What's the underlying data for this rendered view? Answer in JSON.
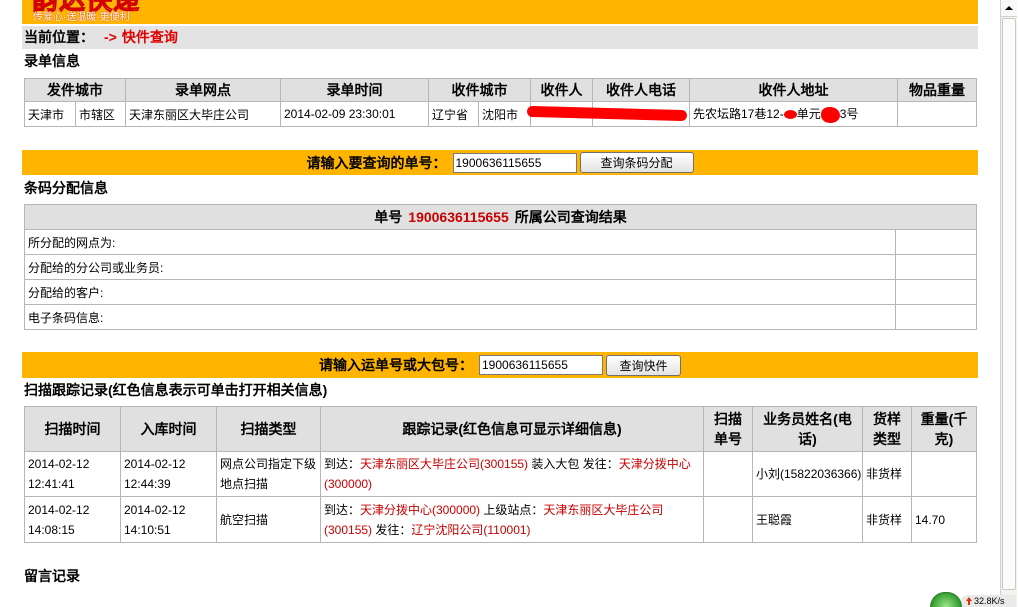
{
  "logo": {
    "name": "韵达快递",
    "slogan": "传爱心·送温暖·更便利"
  },
  "breadcrumb": {
    "label": "当前位置：",
    "arrow": "->",
    "current": "快件查询"
  },
  "order_info": {
    "title": "录单信息",
    "headers": [
      "发件城市",
      "录单网点",
      "录单时间",
      "收件城市",
      "收件人",
      "收件人电话",
      "收件人地址",
      "物品重量"
    ],
    "row": {
      "sender_province": "天津市",
      "sender_district": "市辖区",
      "outlet": "天津东丽区大毕庄公司",
      "time": "2014-02-09 23:30:01",
      "recipient_province": "辽宁省",
      "recipient_city": "沈阳市",
      "recipient_name": "",
      "recipient_phone": "",
      "address_parts": [
        "先农坛路17巷12-",
        "单元",
        "3号"
      ],
      "weight": ""
    }
  },
  "barcode_query": {
    "label": "请输入要查询的单号：",
    "value": "1900636115655",
    "button": "查询条码分配"
  },
  "barcode_info": {
    "title": "条码分配信息",
    "header_prefix": "单号",
    "header_number": "1900636115655",
    "header_suffix": "所属公司查询结果",
    "rows": [
      {
        "label": "所分配的网点为:",
        "value": ""
      },
      {
        "label": "分配给的分公司或业务员:",
        "value": ""
      },
      {
        "label": "分配给的客户:",
        "value": ""
      },
      {
        "label": "电子条码信息:",
        "value": ""
      }
    ]
  },
  "waybill_query": {
    "label": "请输入运单号或大包号：",
    "value": "1900636115655",
    "button": "查询快件"
  },
  "tracking": {
    "title": "扫描跟踪记录(红色信息表示可单击打开相关信息)",
    "headers": [
      "扫描时间",
      "入库时间",
      "扫描类型",
      "跟踪记录(红色信息可显示详细信息)",
      "扫描单号",
      "业务员姓名(电话)",
      "货样类型",
      "重量(千克)"
    ],
    "rows": [
      {
        "scan_time": "2014-02-12 12:41:41",
        "stock_time": "2014-02-12 12:44:39",
        "scan_type": "网点公司指定下级地点扫描",
        "record": [
          {
            "text": "到达：",
            "link": false
          },
          {
            "text": "天津东丽区大毕庄公司(300155)",
            "link": true
          },
          {
            "text": " 装入大包 发往：",
            "link": false
          },
          {
            "text": "天津分拨中心(300000)",
            "link": true
          }
        ],
        "scan_no": "",
        "courier": "小刘(15822036366)",
        "sample_type": "非货样",
        "weight": ""
      },
      {
        "scan_time": "2014-02-12 14:08:15",
        "stock_time": "2014-02-12 14:10:51",
        "scan_type": "航空扫描",
        "record": [
          {
            "text": "到达：",
            "link": false
          },
          {
            "text": "天津分拨中心(300000)",
            "link": true
          },
          {
            "text": " 上级站点：",
            "link": false
          },
          {
            "text": "天津东丽区大毕庄公司(300155)",
            "link": true
          },
          {
            "text": " 发往：",
            "link": false
          },
          {
            "text": "辽宁沈阳公司(110001)",
            "link": true
          }
        ],
        "scan_no": "",
        "courier": "王聪霞",
        "sample_type": "非货样",
        "weight": "14.70"
      }
    ]
  },
  "messages": {
    "title": "留言记录"
  },
  "net_speed": {
    "value": "32.8K/s",
    "icon": "speed-ball-icon",
    "direction_icon": "upload-arrow-icon"
  },
  "colors": {
    "accent": "#FFB400",
    "link_red": "#C80000",
    "crumb_red": "#E00000",
    "header_gray": "#E0E0E0"
  }
}
